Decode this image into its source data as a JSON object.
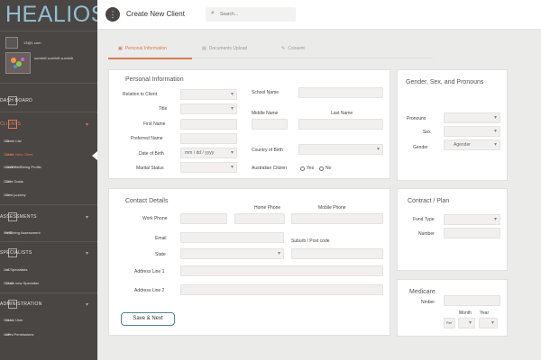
{
  "sidebar": {
    "logo": "HEALIOS",
    "user_small": "13@1.com",
    "user_name": "sumiki8 sumiki8 sumiki8",
    "sections": [
      {
        "label": "DASH BOARD"
      },
      {
        "label": "CLIENTS"
      },
      {
        "label": "ASSESSMENTS"
      },
      {
        "label": "SPECIALISTS"
      },
      {
        "label": "ADMINISTRATION"
      }
    ],
    "client_items": [
      {
        "abbr": "CL",
        "label": "Clients List"
      },
      {
        "abbr": "CNC",
        "label": "Create New Client"
      },
      {
        "abbr": "CWBP",
        "label": "Client WellBeing Profile"
      },
      {
        "abbr": "CG",
        "label": "Client Goals"
      },
      {
        "abbr": "CJ",
        "label": "Client journey"
      }
    ],
    "assessment_items": [
      {
        "abbr": "WB",
        "label": "WellBeing Assessment"
      }
    ],
    "specialist_items": [
      {
        "abbr": "LC",
        "label": "List Specialists"
      },
      {
        "abbr": "CNC",
        "label": "Create new Specialist"
      }
    ],
    "admin_items": [
      {
        "abbr": "CU",
        "label": "Create User"
      },
      {
        "abbr": "UP",
        "label": "Users Permissions"
      }
    ]
  },
  "topbar": {
    "title": "Create New Client",
    "search_placeholder": "Search..."
  },
  "tabs": [
    "Personal Information",
    "Documents Upload",
    "Consent"
  ],
  "personal": {
    "title": "Personal Information",
    "relation_label": "Relation to Client",
    "title_label": "Title",
    "first_label": "First Name",
    "preferred_label": "Preferred Name",
    "dob_label": "Date of Birth",
    "dob_placeholder": "mm / dd / yyyy",
    "marital_label": "Marital Status",
    "school_label": "School Name",
    "middle_label": "Middle Name",
    "last_label": "Last Name",
    "country_label": "Country of Birth",
    "australian_label": "Australian Citizen",
    "yes": "Yes",
    "no": "No"
  },
  "gender": {
    "title": "Gender, Sex, and Pronouns",
    "pronouns_label": "Pronouns",
    "sex_label": "Sex",
    "gender_label": "Gender",
    "gender_value": "Agender"
  },
  "contact": {
    "title": "Contact Details",
    "work_label": "Work Phone",
    "home_label": "Home Phone",
    "mobile_label": "Mobile Phone",
    "email_label": "Email",
    "state_label": "State",
    "suburb_label": "Suburb / Post code",
    "addr1_label": "Address Line 1",
    "addr2_label": "Address Line 2"
  },
  "contract": {
    "title": "Contract / Plan",
    "fund_label": "Fund Type",
    "number_label": "Number"
  },
  "medicare": {
    "title": "Medicare",
    "number_label": "Nmber",
    "month_label": "Month",
    "year_label": "Year",
    "ref_placeholder": "Ref"
  },
  "save_next": "Save & Next"
}
